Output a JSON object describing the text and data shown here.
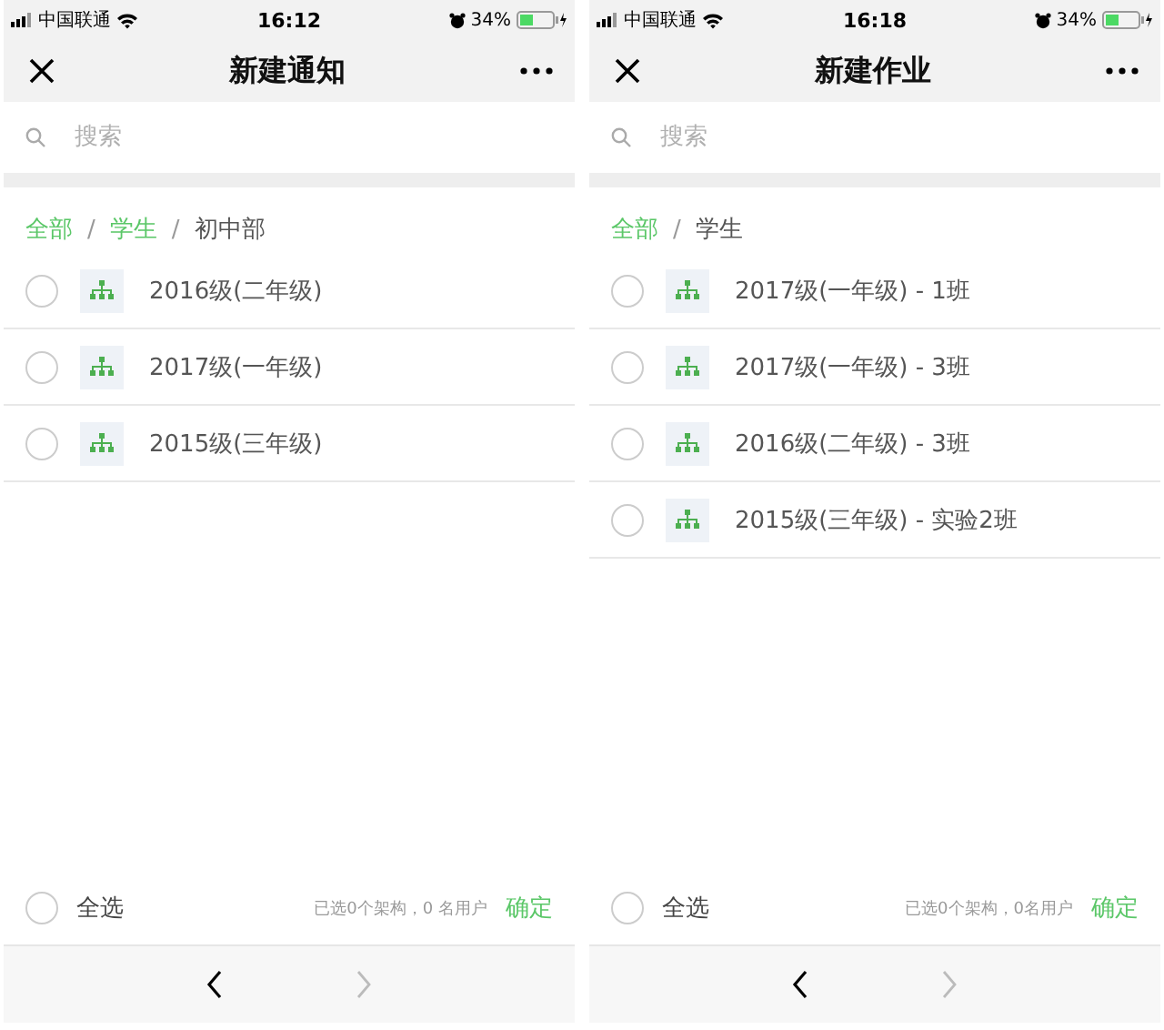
{
  "screens": [
    {
      "status_bar": {
        "carrier": "中国联通",
        "time": "16:12",
        "battery": "34%"
      },
      "title": "新建通知",
      "search": {
        "placeholder": "搜索"
      },
      "breadcrumb_separator": "/",
      "breadcrumb": [
        {
          "label": "全部",
          "current": false
        },
        {
          "label": "学生",
          "current": false
        },
        {
          "label": "初中部",
          "current": true
        }
      ],
      "items": [
        {
          "label": "2016级(二年级)",
          "checked": false
        },
        {
          "label": "2017级(一年级)",
          "checked": false
        },
        {
          "label": "2015级(三年级)",
          "checked": false
        }
      ],
      "footer": {
        "select_all": "全选",
        "checked": false,
        "summary": "已选0个架构，0 名用户",
        "confirm": "确定"
      }
    },
    {
      "status_bar": {
        "carrier": "中国联通",
        "time": "16:18",
        "battery": "34%"
      },
      "title": "新建作业",
      "search": {
        "placeholder": "搜索"
      },
      "breadcrumb_separator": "/",
      "breadcrumb": [
        {
          "label": "全部",
          "current": false
        },
        {
          "label": "学生",
          "current": true
        }
      ],
      "items": [
        {
          "label": "2017级(一年级) - 1班",
          "checked": false
        },
        {
          "label": "2017级(一年级) - 3班",
          "checked": false
        },
        {
          "label": "2016级(二年级) - 3班",
          "checked": false
        },
        {
          "label": "2015级(三年级) - 实验2班",
          "checked": false
        }
      ],
      "footer": {
        "select_all": "全选",
        "checked": false,
        "summary": "已选0个架构，0名用户",
        "confirm": "确定"
      }
    }
  ]
}
